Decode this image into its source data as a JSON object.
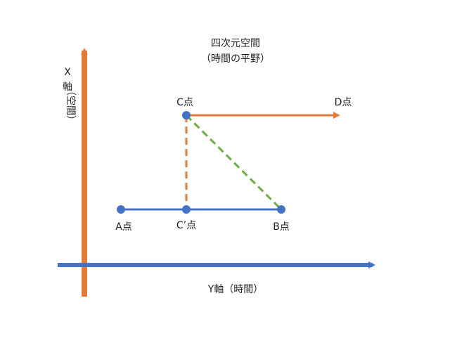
{
  "title": {
    "line1": "四次元空間",
    "line2": "（時間の平野）"
  },
  "axes": {
    "x_axis_label": "Y軸（時間）",
    "y_axis_label_top": "X",
    "y_axis_label_mid": "軸",
    "y_axis_label_paren": "（空間）"
  },
  "points": {
    "a": "A点",
    "b": "B点",
    "c": "C点",
    "c_prime": "C’点",
    "d": "D点"
  },
  "colors": {
    "orange": "#e07b39",
    "blue": "#4472c4",
    "green": "#70ad47"
  }
}
